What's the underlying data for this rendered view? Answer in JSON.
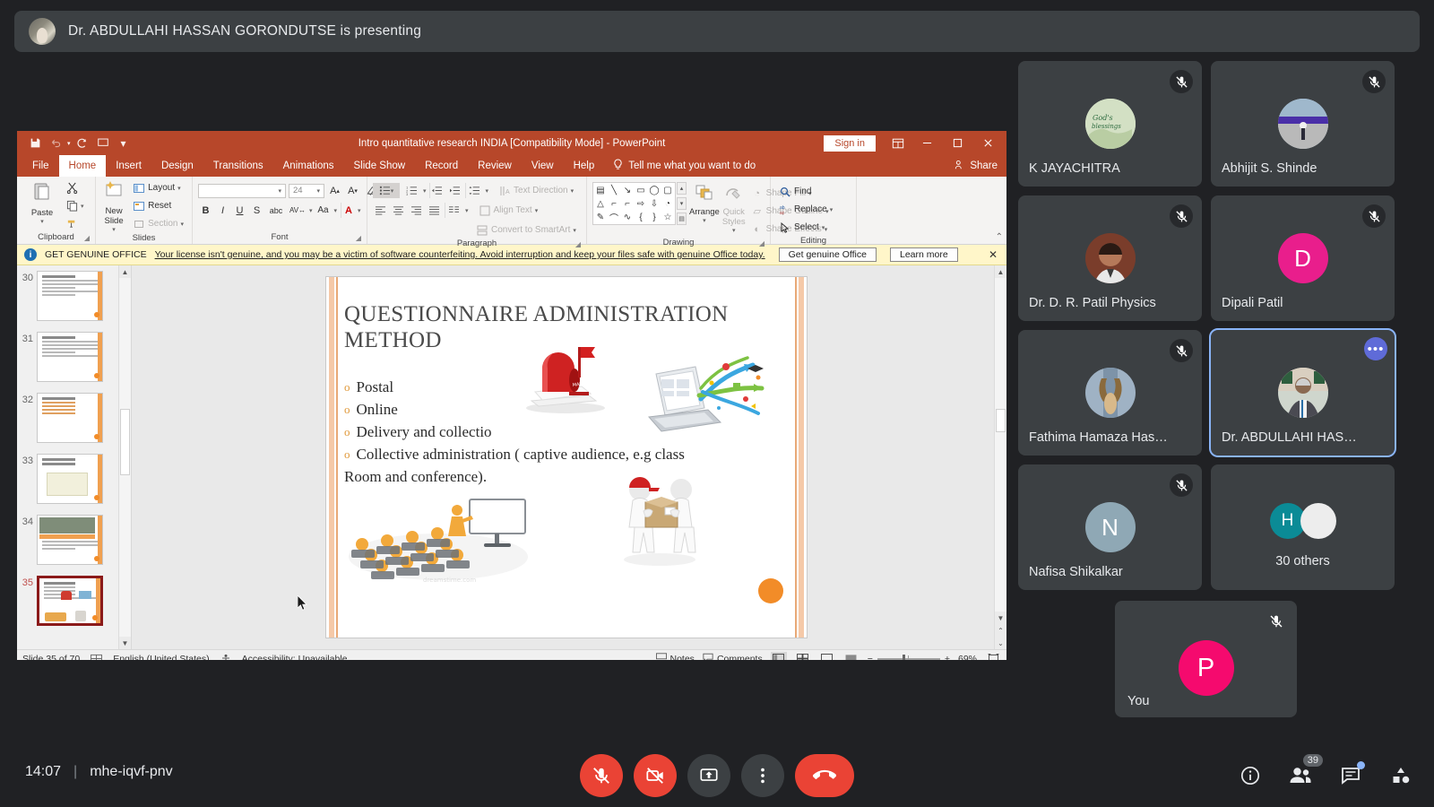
{
  "meet": {
    "presenting_banner": "Dr. ABDULLAHI HASSAN GORONDUTSE is presenting",
    "time": "14:07",
    "separator": "|",
    "meeting_code": "mhe-iqvf-pnv",
    "participant_count": "39",
    "accent_blue": "#8ab4f8",
    "danger_red": "#ea4335",
    "tiles": [
      {
        "name": "K JAYACHITRA",
        "muted": true,
        "avatar_type": "photo-quote",
        "initial": ""
      },
      {
        "name": "Abhijit S. Shinde",
        "muted": true,
        "avatar_type": "photo-airport",
        "initial": ""
      },
      {
        "name": "Dr. D. R. Patil Physics",
        "muted": true,
        "avatar_type": "photo-person",
        "initial": ""
      },
      {
        "name": "Dipali Patil",
        "muted": true,
        "avatar_type": "initial",
        "initial": "D",
        "avatar_color": "#e91e8c"
      },
      {
        "name": "Fathima Hamaza Hassee…",
        "muted": true,
        "avatar_type": "photo-statue",
        "initial": ""
      },
      {
        "name": "Dr. ABDULLAHI HASSAN …",
        "muted": false,
        "avatar_type": "photo-presenter",
        "initial": "",
        "active": true,
        "more_label": "•••"
      },
      {
        "name": "Nafisa Shikalkar",
        "muted": true,
        "avatar_type": "initial",
        "initial": "N",
        "avatar_color": "#8fa8b5"
      },
      {
        "name": "30 others",
        "muted": false,
        "avatar_type": "others",
        "initial": "H",
        "avatar_color": "#0b8b96"
      }
    ],
    "self_tile": {
      "name": "You",
      "initial": "P",
      "muted": true,
      "avatar_color": "#f50a6e"
    },
    "controls": [
      {
        "name": "microphone-off",
        "icon": "mic-slash",
        "style": "danger"
      },
      {
        "name": "camera-off",
        "icon": "camera-slash",
        "style": "danger"
      },
      {
        "name": "present-screen",
        "icon": "present",
        "style": "neutral"
      },
      {
        "name": "more-options",
        "icon": "dots-vertical",
        "style": "neutral"
      },
      {
        "name": "leave-call",
        "icon": "phone-hangup",
        "style": "hangup"
      }
    ],
    "right_icons": [
      {
        "name": "meeting-details",
        "icon": "info"
      },
      {
        "name": "people",
        "icon": "people",
        "badge": "39"
      },
      {
        "name": "chat",
        "icon": "chat",
        "unread": true
      },
      {
        "name": "activities",
        "icon": "activities"
      }
    ]
  },
  "powerpoint": {
    "title": "Intro quantitative research INDIA [Compatibility Mode]  -  PowerPoint",
    "sign_in": "Sign in",
    "share": "Share",
    "tell_me": "Tell me what you want to do",
    "quick_access": [
      "save-icon",
      "undo-icon",
      "redo-icon",
      "start-presentation-icon",
      "customize-qat-icon"
    ],
    "window_buttons": [
      "ribbon-display-options",
      "minimize",
      "restore",
      "close"
    ],
    "tabs": [
      "File",
      "Home",
      "Insert",
      "Design",
      "Transitions",
      "Animations",
      "Slide Show",
      "Record",
      "Review",
      "View",
      "Help"
    ],
    "active_tab": "Home",
    "ribbon": {
      "groups": [
        "Clipboard",
        "Slides",
        "Font",
        "Paragraph",
        "Drawing",
        "Editing"
      ],
      "clipboard": {
        "paste": "Paste",
        "cut": "cut-icon",
        "copy": "copy-icon",
        "format_painter": "format-painter-icon"
      },
      "slides": {
        "new_slide": "New Slide",
        "layout": "Layout",
        "reset": "Reset",
        "section": "Section"
      },
      "font": {
        "font_name": "",
        "font_size": "24",
        "bold": "B",
        "italic": "I",
        "underline": "U",
        "shadow": "S",
        "strikethrough": "abc"
      },
      "paragraph": {
        "text_direction": "Text Direction",
        "align_text": "Align Text",
        "convert_smartart": "Convert to SmartArt"
      },
      "drawing": {
        "arrange": "Arrange",
        "quick_styles": "Quick Styles",
        "shape_fill": "Shape Fill",
        "shape_outline": "Shape Outline",
        "shape_effects": "Shape Effects"
      },
      "editing": {
        "find": "Find",
        "replace": "Replace",
        "select": "Select"
      }
    },
    "notice": {
      "label": "GET GENUINE OFFICE",
      "message": "Your license isn't genuine, and you may be a victim of software counterfeiting. Avoid interruption and keep your files safe with genuine Office today.",
      "button_primary": "Get genuine Office",
      "button_secondary": "Learn more",
      "close": "✕"
    },
    "thumbnails": [
      {
        "number": "30",
        "selected": false
      },
      {
        "number": "31",
        "selected": false
      },
      {
        "number": "32",
        "selected": false
      },
      {
        "number": "33",
        "selected": false
      },
      {
        "number": "34",
        "selected": false
      },
      {
        "number": "35",
        "selected": true
      }
    ],
    "slide": {
      "title": "Questionnaire administration method",
      "bullets": [
        "Postal",
        "Online",
        "Delivery and collectio",
        "Collective administration ( captive audience, e.g class"
      ],
      "continuation": "Room and conference).",
      "images": [
        "mailbox",
        "laptop-with-arrows",
        "classroom-audience",
        "package-delivery"
      ]
    },
    "status": {
      "slide_position": "Slide 35 of 70",
      "language": "English (United States)",
      "accessibility": "Accessibility: Unavailable",
      "notes": "Notes",
      "comments": "Comments",
      "zoom": "69%",
      "zoom_out": "−",
      "zoom_in": "+",
      "views": [
        "normal-view",
        "slide-sorter-view",
        "reading-view",
        "slide-show-view"
      ]
    }
  }
}
